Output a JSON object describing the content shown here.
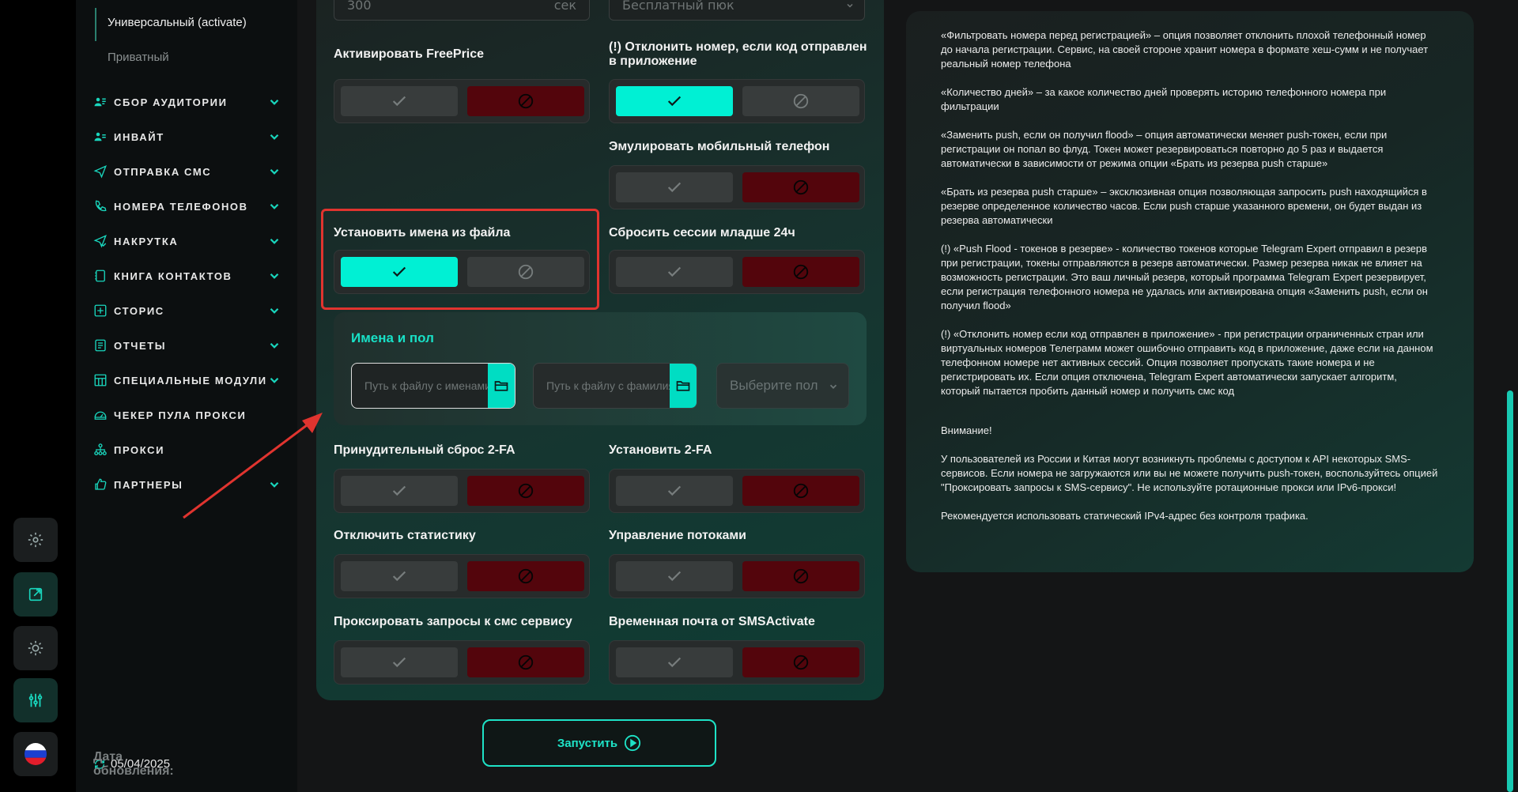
{
  "sidebar": {
    "sub_items": [
      "Универсальный (activate)",
      "Приватный"
    ],
    "nav": [
      {
        "label": "СБОР АУДИТОРИИ",
        "icon": "users-icon",
        "chevron": true
      },
      {
        "label": "ИНВАЙТ",
        "icon": "user-add-icon",
        "chevron": true
      },
      {
        "label": "ОТПРАВКА СМС",
        "icon": "send-icon",
        "chevron": true
      },
      {
        "label": "НОМЕРА ТЕЛЕФОНОВ",
        "icon": "phone-icon",
        "chevron": true
      },
      {
        "label": "НАКРУТКА",
        "icon": "boost-icon",
        "chevron": true
      },
      {
        "label": "КНИГА КОНТАКТОВ",
        "icon": "contacts-icon",
        "chevron": true
      },
      {
        "label": "СТОРИС",
        "icon": "stories-icon",
        "chevron": true
      },
      {
        "label": "ОТЧЕТЫ",
        "icon": "reports-icon",
        "chevron": true
      },
      {
        "label": "СПЕЦИАЛЬНЫЕ МОДУЛИ",
        "icon": "modules-icon",
        "chevron": true
      },
      {
        "label": "ЧЕКЕР ПУЛА ПРОКСИ",
        "icon": "gauge-icon",
        "chevron": false
      },
      {
        "label": "ПРОКСИ",
        "icon": "proxy-icon",
        "chevron": false
      },
      {
        "label": "ПАРТНЕРЫ",
        "icon": "partners-icon",
        "chevron": true
      }
    ],
    "update_label": "Дата обновления:",
    "update_value": "05/04/2025"
  },
  "top_fields": {
    "seconds_value": "300",
    "seconds_unit": "сек",
    "pool_value": "Бесплатный пюк"
  },
  "options": {
    "freeprice": "Активировать FreePrice",
    "reject_app_code": "(!) Отклонить номер, если код отправлен в приложение",
    "emulate_mobile": "Эмулировать мобильный телефон",
    "set_names": "Установить имена из файла",
    "reset_sessions": "Сбросить сессии младше 24ч",
    "force_reset_2fa": "Принудительный сброс 2-FA",
    "set_2fa": "Установить 2-FA",
    "disable_stats": "Отключить статистику",
    "thread_control": "Управление потоками",
    "proxy_sms": "Проксировать запросы к смс сервису",
    "temp_mail": "Временная почта от SMSActivate"
  },
  "names": {
    "title": "Имена и пол",
    "names_placeholder": "Путь к файлу с именами",
    "surnames_placeholder": "Путь к файлу с фамилиями",
    "gender_placeholder": "Выберите пол"
  },
  "run_label": "Запустить",
  "info": [
    "«Фильтровать номера перед регистрацией» – опция позволяет отклонить плохой телефонный номер до начала регистрации. Сервис, на своей стороне хранит номера в формате хеш-сумм и не получает реальный номер телефона",
    "«Количество дней» – за какое количество дней проверять историю телефонного номера при фильтрации",
    "«Заменить push, если он получил flood» – опция автоматически меняет push-токен, если при регистрации он попал во флуд. Токен может резервироваться повторно до 5 раз и выдается автоматически в зависимости от режима опции «Брать из резерва push старше»",
    "«Брать из резерва push старше» – эксклюзивная опция позволяющая запросить push находящийся в резерве определенное количество часов. Если push старше указанного времени, он будет выдан из резерва автоматически",
    "(!) «Push Flood - токенов в резерве» - количество токенов которые Telegram Expert отправил в резерв при регистрации, токены отправляются в резерв автоматически. Размер резерва никак не влияет на возможность регистрации. Это ваш личный резерв, который программа Telegram Expert резервирует, если регистрация телефонного номера не удалась или активирована опция «Заменить push, если он получил flood»",
    "(!) «Отклонить номер если код отправлен в приложение» - при регистрации ограниченных стран или виртуальных номеров Телеграмм может ошибочно отправить код в приложение, даже если на данном телефонном номере нет активных сессий. Опция позволяет пропускать такие номера и не регистрировать их. Если опция отключена, Telegram Expert автоматически запускает алгоритм, который пытается пробить данный номер и получить смс код",
    "Внимание!",
    "У пользователей из России и Китая могут возникнуть проблемы с доступом к API некоторых SMS-сервисов. Если номера не загружаются или вы не можете получить push-токен, воспользуйтесь опцией \"Проксировать запросы к SMS-сервису\". Не используйте ротационные прокси или IPv6-прокси!",
    "Рекомендуется использовать статический IPv4-адрес без контроля трафика."
  ]
}
